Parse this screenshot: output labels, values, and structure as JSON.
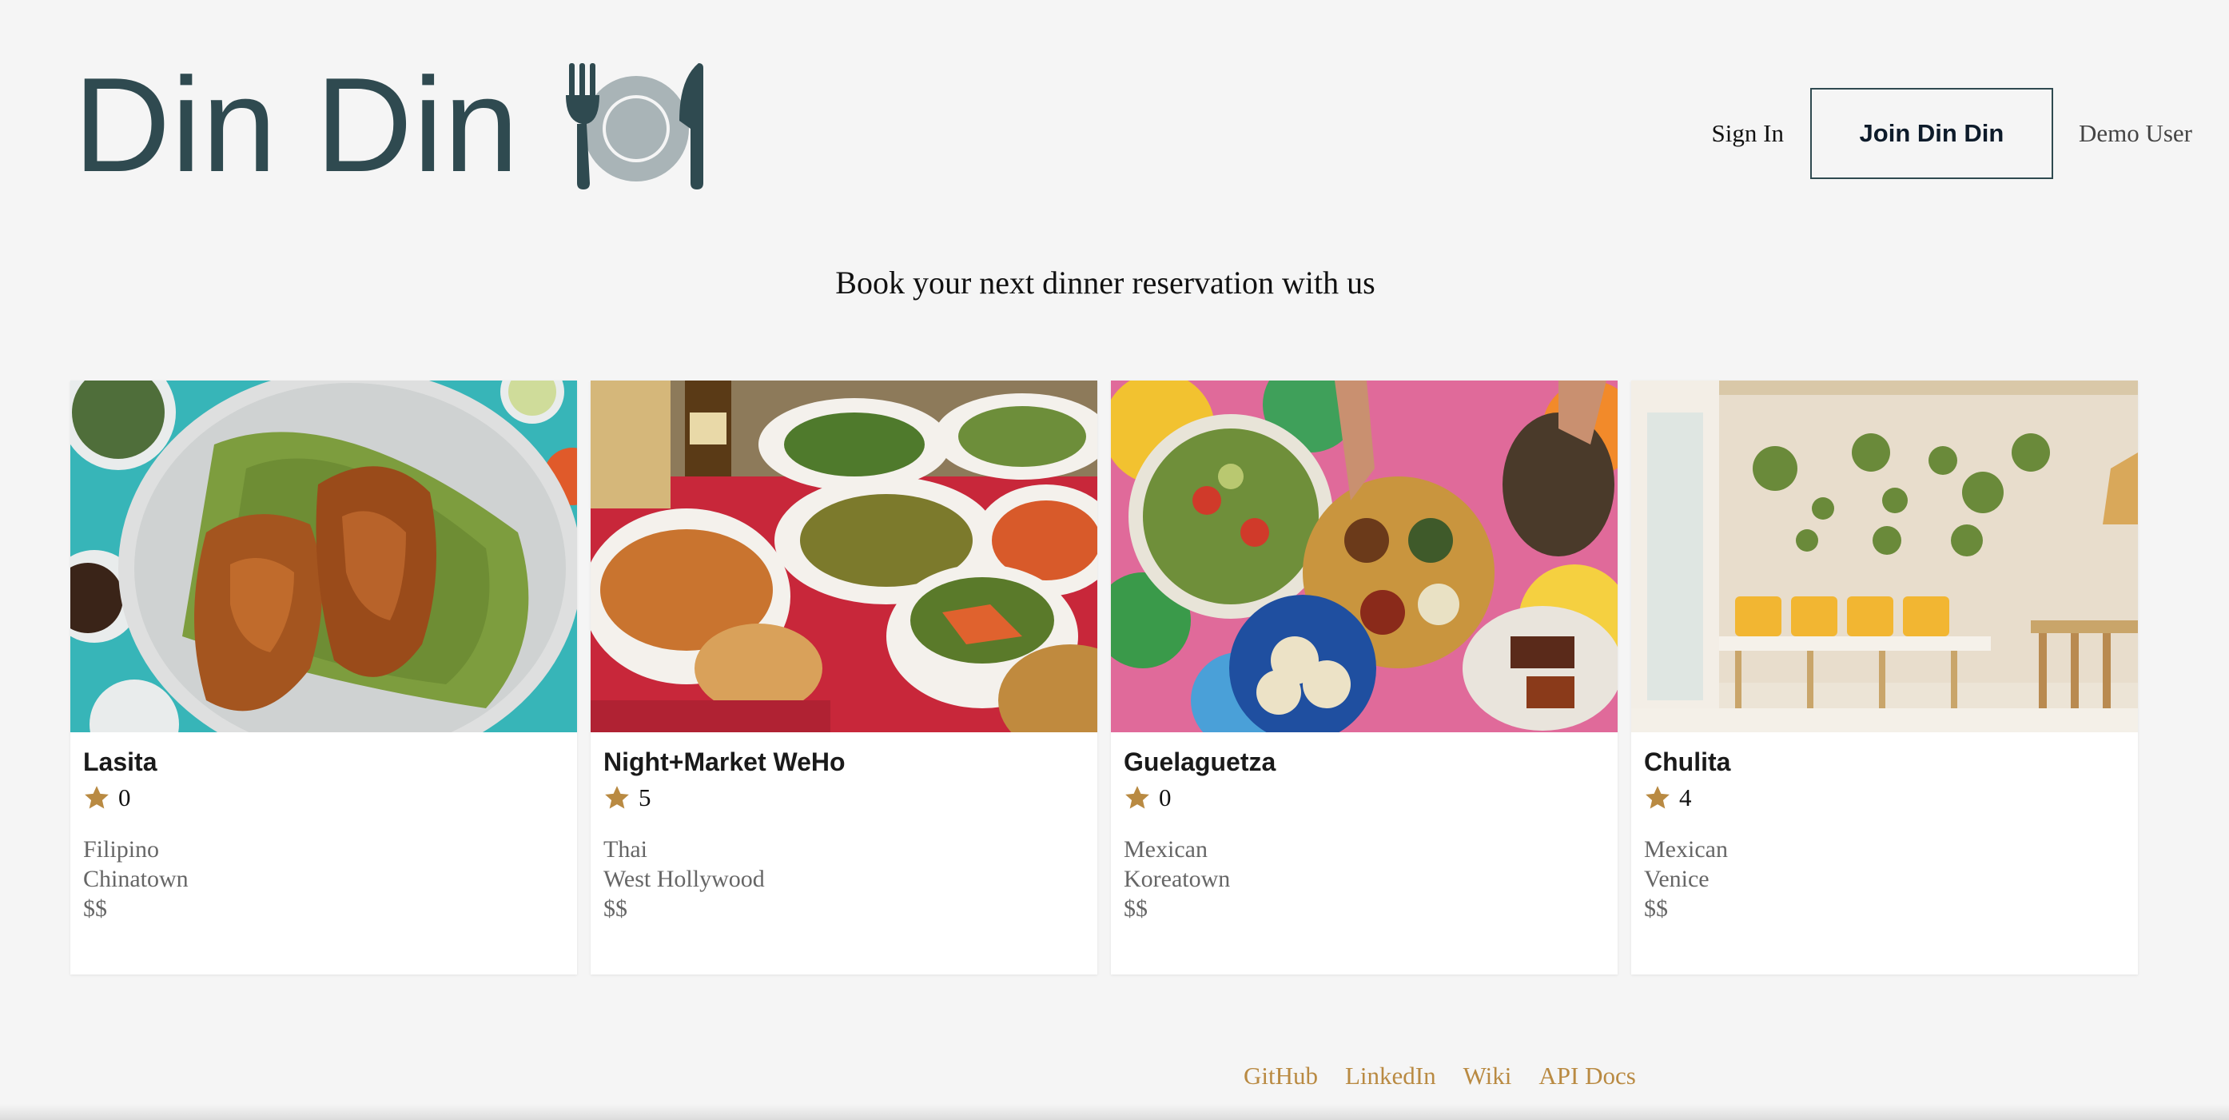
{
  "brand": {
    "name": "Din Din",
    "icon": "fork-plate-knife-icon",
    "color": "#2f4a50"
  },
  "nav": {
    "sign_in": "Sign In",
    "join": "Join Din Din",
    "demo_user": "Demo User"
  },
  "tagline": "Book your next dinner reservation with us",
  "restaurants": [
    {
      "name": "Lasita",
      "rating": "0",
      "cuisine": "Filipino",
      "neighborhood": "Chinatown",
      "price": "$$",
      "image": "roasted-chicken-photo"
    },
    {
      "name": "Night+Market WeHo",
      "rating": "5",
      "cuisine": "Thai",
      "neighborhood": "West Hollywood",
      "price": "$$",
      "image": "thai-dishes-photo"
    },
    {
      "name": "Guelaguetza",
      "rating": "0",
      "cuisine": "Mexican",
      "neighborhood": "Koreatown",
      "price": "$$",
      "image": "mexican-feast-photo"
    },
    {
      "name": "Chulita",
      "rating": "4",
      "cuisine": "Mexican",
      "neighborhood": "Venice",
      "price": "$$",
      "image": "restaurant-interior-photo"
    }
  ],
  "footer": {
    "github": "GitHub",
    "linkedin": "LinkedIn",
    "wiki": "Wiki",
    "api_docs": "API Docs"
  },
  "colors": {
    "background": "#f5f5f5",
    "star": "#b98a42",
    "footer_link": "#b98a42",
    "text_muted": "#666666"
  }
}
